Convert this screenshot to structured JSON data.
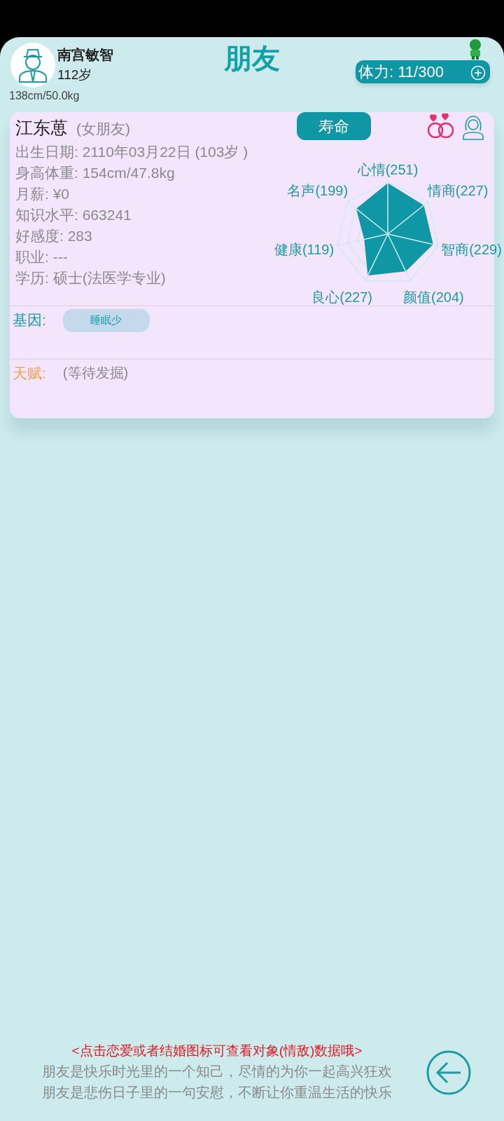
{
  "player": {
    "name": "南宫敏智",
    "age": "112岁",
    "body": "138cm/50.0kg"
  },
  "title": "朋友",
  "stamina": {
    "text": "体力: 11/300"
  },
  "friend": {
    "name": "江东葸",
    "relation": "(女朋友)",
    "lifespan_button": "寿命",
    "details": [
      "出生日期: 2110年03月22日 (103岁 )",
      "身高体重: 154cm/47.8kg",
      "月薪: ¥0",
      "知识水平: 663241",
      "好感度: 283",
      "职业: ---",
      "学历: 硕士(法医学专业)"
    ],
    "stats": [
      {
        "label": "心情(251)"
      },
      {
        "label": "情商(227)"
      },
      {
        "label": "智商(229)"
      },
      {
        "label": "颜值(204)"
      },
      {
        "label": "良心(227)"
      },
      {
        "label": "健康(119)"
      },
      {
        "label": "名声(199)"
      }
    ],
    "genes": {
      "label": "基因:",
      "tags": [
        "睡眠少"
      ]
    },
    "talent": {
      "label": "天赋:",
      "value": "(等待发掘)"
    }
  },
  "hint": "<点击恋爱或者结婚图标可查看对象(情敌)数据哦>",
  "quote": [
    "朋友是快乐时光里的一个知己，尽情的为你一起高兴狂欢",
    "朋友是悲伤日子里的一句安慰，不断让你重温生活的快乐"
  ]
}
